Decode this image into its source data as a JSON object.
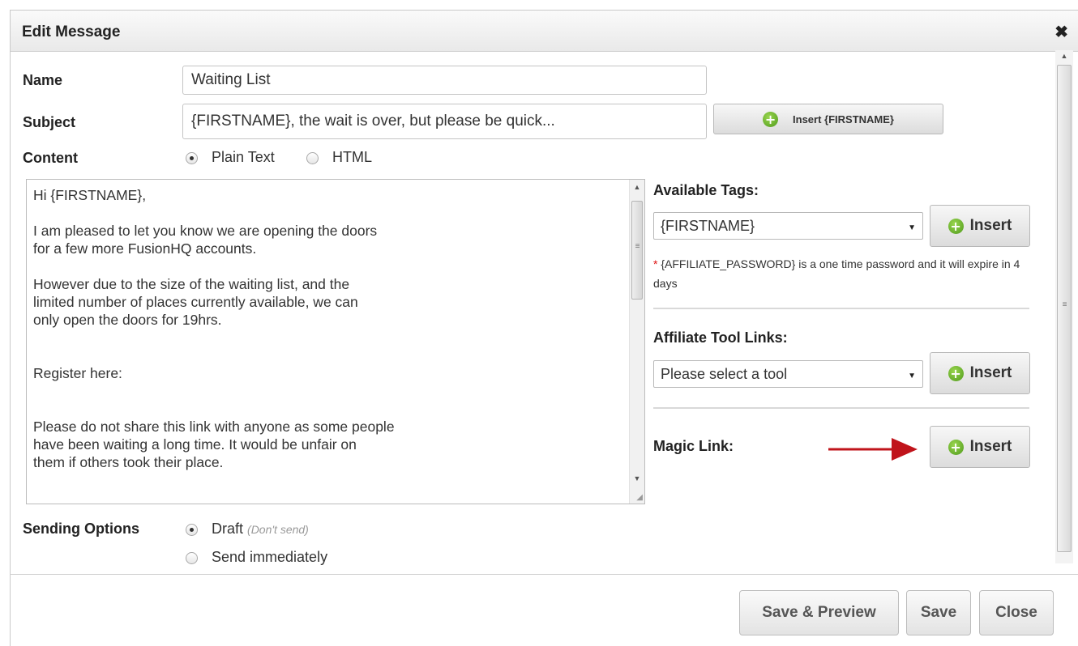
{
  "dialog": {
    "title": "Edit Message",
    "close_symbol": "✖"
  },
  "form": {
    "name_label": "Name",
    "name_value": "Waiting List",
    "subject_label": "Subject",
    "subject_value": "{FIRSTNAME}, the wait is over, but please be quick...",
    "insert_firstname_label": "Insert {FIRSTNAME}",
    "content_label": "Content",
    "content_options": [
      {
        "label": "Plain Text",
        "selected": true
      },
      {
        "label": "HTML",
        "selected": false
      }
    ],
    "body_text": "Hi {FIRSTNAME},\n\nI am pleased to let you know we are opening the doors\nfor a few more FusionHQ accounts.\n\nHowever due to the size of the waiting list, and the\nlimited number of places currently available, we can\nonly open the doors for 19hrs.\n\n\nRegister here:\n\n\nPlease do not share this link with anyone as some people\nhave been waiting a long time. It would be unfair on\nthem if others took their place.",
    "sending_label": "Sending Options",
    "sending_options": [
      {
        "label": "Draft",
        "hint": "(Don't send)",
        "selected": true
      },
      {
        "label": "Send immediately",
        "selected": false
      }
    ]
  },
  "side": {
    "tags_label": "Available Tags:",
    "tags_selected": "{FIRSTNAME}",
    "insert_label": "Insert",
    "note_star": "*",
    "note_text": "{AFFILIATE_PASSWORD} is a one time password and it will expire in 4 days",
    "affiliate_label": "Affiliate Tool Links:",
    "affiliate_placeholder": "Please select a tool",
    "magic_label": "Magic Link:"
  },
  "footer": {
    "save_preview": "Save & Preview",
    "save": "Save",
    "close": "Close"
  },
  "colors": {
    "arrow": "#c0141b",
    "plus_green": "#5fae24"
  }
}
